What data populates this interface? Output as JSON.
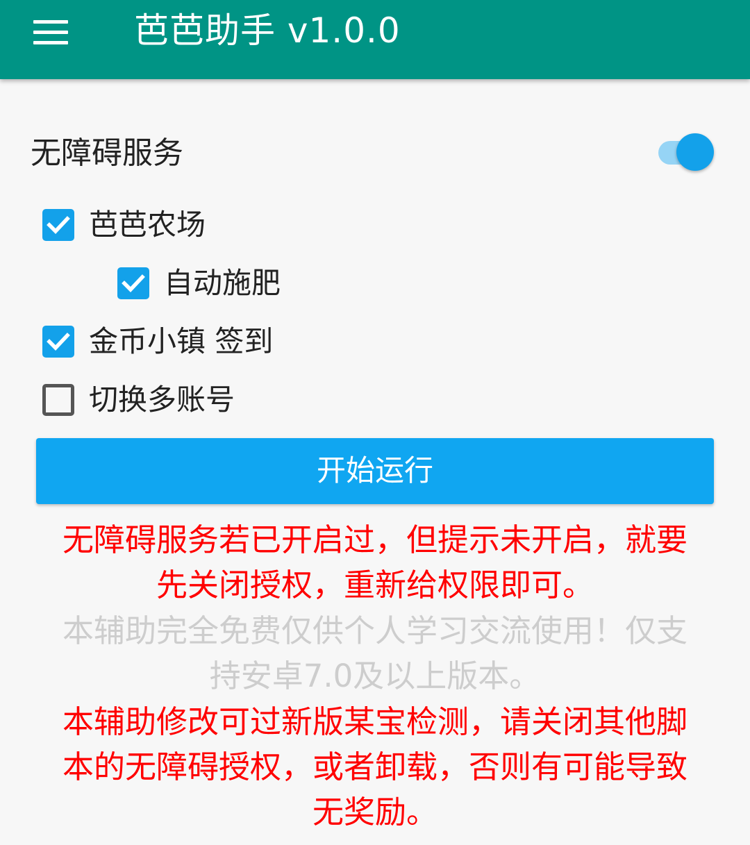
{
  "appbar": {
    "title": "芭芭助手 v1.0.0",
    "menu_icon": "hamburger-menu-icon",
    "background_color": "#009485"
  },
  "service": {
    "label": "无障碍服务",
    "switch_on": true,
    "accent_color": "#13a1ea"
  },
  "options": [
    {
      "label": "芭芭农场",
      "checked": true
    },
    {
      "label": "自动施肥",
      "checked": true
    },
    {
      "label": "金币小镇 签到",
      "checked": true
    },
    {
      "label": "切换多账号",
      "checked": false
    }
  ],
  "start_button": {
    "label": "开始运行",
    "color": "#10a6f1"
  },
  "notices": {
    "warning_1_line1": "无障碍服务若已开启过，但提示未开启，就要",
    "warning_1_line2": "先关闭授权，重新给权限即可。",
    "info_line1": "本辅助完全免费仅供个人学习交流使用！仅支",
    "info_line2": "持安卓7.0及以上版本。",
    "warning_2_line1": "本辅助修改可过新版某宝检测，请关闭其他脚",
    "warning_2_line2": "本的无障碍授权，或者卸载，否则有可能导致",
    "warning_2_line3": "无奖励。",
    "red_color": "#ff0000",
    "gray_color": "#cdcdcd"
  }
}
